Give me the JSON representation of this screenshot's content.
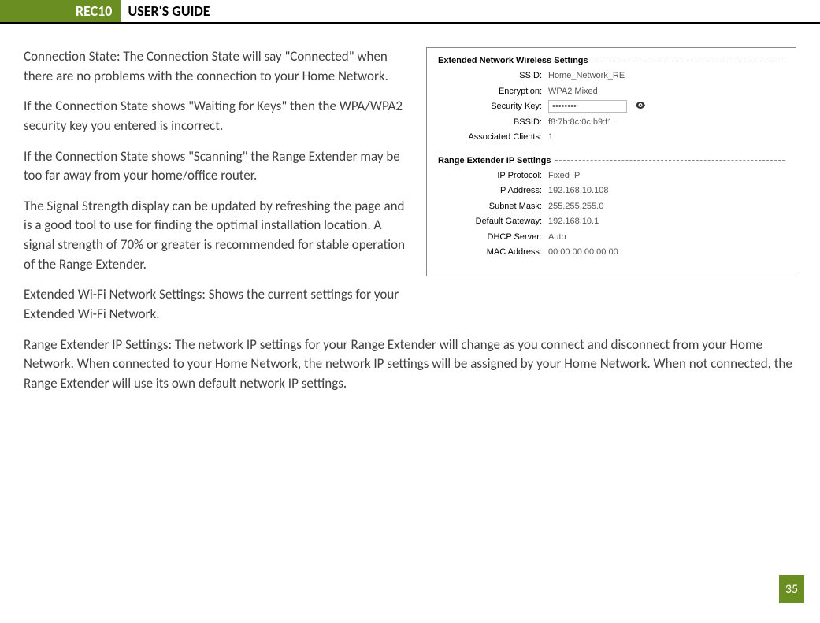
{
  "header": {
    "logo": "REC10",
    "title": "USER'S GUIDE"
  },
  "body": {
    "p1": "Connection State: The Connection State will say \"Connected\" when there are no problems with the connection to your Home Network.",
    "p2": "If the Connection State shows \"Waiting for Keys\" then the WPA/WPA2 security key you entered is incorrect.",
    "p3": "If the Connection State shows \"Scanning\" the Range Extender may be too far away from your home/office router.",
    "p4": "The Signal Strength display can be updated by refreshing the page and is a good tool to use for finding the optimal installation location. A signal strength of 70% or greater is recommended for stable operation of the Range Extender.",
    "p5": "Extended Wi-Fi Network Settings: Shows the current settings for your Extended Wi-Fi Network.",
    "p6": "Range Extender IP Settings:  The network IP settings for your Range Extender will change as you connect and disconnect from your Home Network. When connected to your Home Network, the network IP settings will be assigned by your Home Network. When not connected, the Range Extender will use its own default network IP settings."
  },
  "panel": {
    "section1_title": "Extended Network Wireless Settings",
    "ssid_label": "SSID:",
    "ssid_value": "Home_Network_RE",
    "encryption_label": "Encryption:",
    "encryption_value": "WPA2 Mixed",
    "seckey_label": "Security Key:",
    "seckey_value": "••••••••",
    "bssid_label": "BSSID:",
    "bssid_value": "f8:7b:8c:0c:b9:f1",
    "clients_label": "Associated Clients:",
    "clients_value": "1",
    "section2_title": "Range Extender IP Settings",
    "ipproto_label": "IP Protocol:",
    "ipproto_value": "Fixed IP",
    "ipaddr_label": "IP Address:",
    "ipaddr_value": "192.168.10.108",
    "subnet_label": "Subnet Mask:",
    "subnet_value": "255.255.255.0",
    "gateway_label": "Default Gateway:",
    "gateway_value": "192.168.10.1",
    "dhcp_label": "DHCP Server:",
    "dhcp_value": "Auto",
    "mac_label": "MAC Address:",
    "mac_value": "00:00:00:00:00:00"
  },
  "page_number": "35"
}
